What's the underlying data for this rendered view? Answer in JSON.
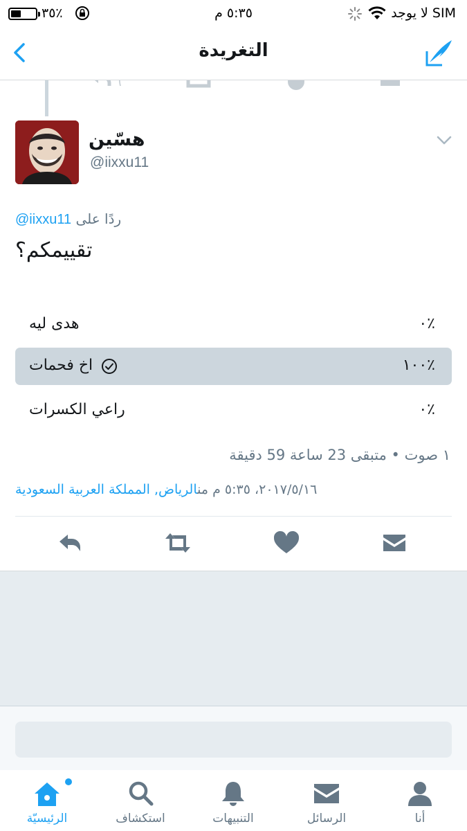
{
  "status_bar": {
    "carrier": "لا يوجد SIM",
    "time": "٥:٣٥ م",
    "battery": "٣٥٪"
  },
  "nav": {
    "title": "التغريدة"
  },
  "tweet": {
    "display_name": "هسّين",
    "handle": "@iixxu11",
    "reply_prefix": "ردًا على",
    "reply_mention": "@iixxu11",
    "text": "تقييمكم؟",
    "poll": {
      "options": [
        {
          "label": "هدى ليه",
          "percent": "٠٪",
          "winner": false
        },
        {
          "label": "اخ فحمات",
          "percent": "١٠٠٪",
          "winner": true
        },
        {
          "label": "راعي الكسرات",
          "percent": "٠٪",
          "winner": false
        }
      ],
      "meta": "١ صوت • متبقى 23 ساعة 59 دقيقة"
    },
    "location": "الرياض, المملكة العربية السعودية",
    "from_prefix": "من",
    "timestamp": "٢٠١٧/٥/١٦، ٥:٣٥ م"
  },
  "tabs": [
    {
      "label": "الرئيسيّة",
      "icon": "home-icon",
      "active": true
    },
    {
      "label": "استكشاف",
      "icon": "search-icon",
      "active": false
    },
    {
      "label": "التنبيهات",
      "icon": "bell-icon",
      "active": false
    },
    {
      "label": "الرسائل",
      "icon": "envelope-icon",
      "active": false
    },
    {
      "label": "أنا",
      "icon": "person-icon",
      "active": false
    }
  ],
  "colors": {
    "accent": "#1da1f2",
    "secondary_text": "#657786",
    "icon_gray": "#657786",
    "poll_winner_bg": "#ccd6dd",
    "background_gray": "#e6ecf0"
  }
}
